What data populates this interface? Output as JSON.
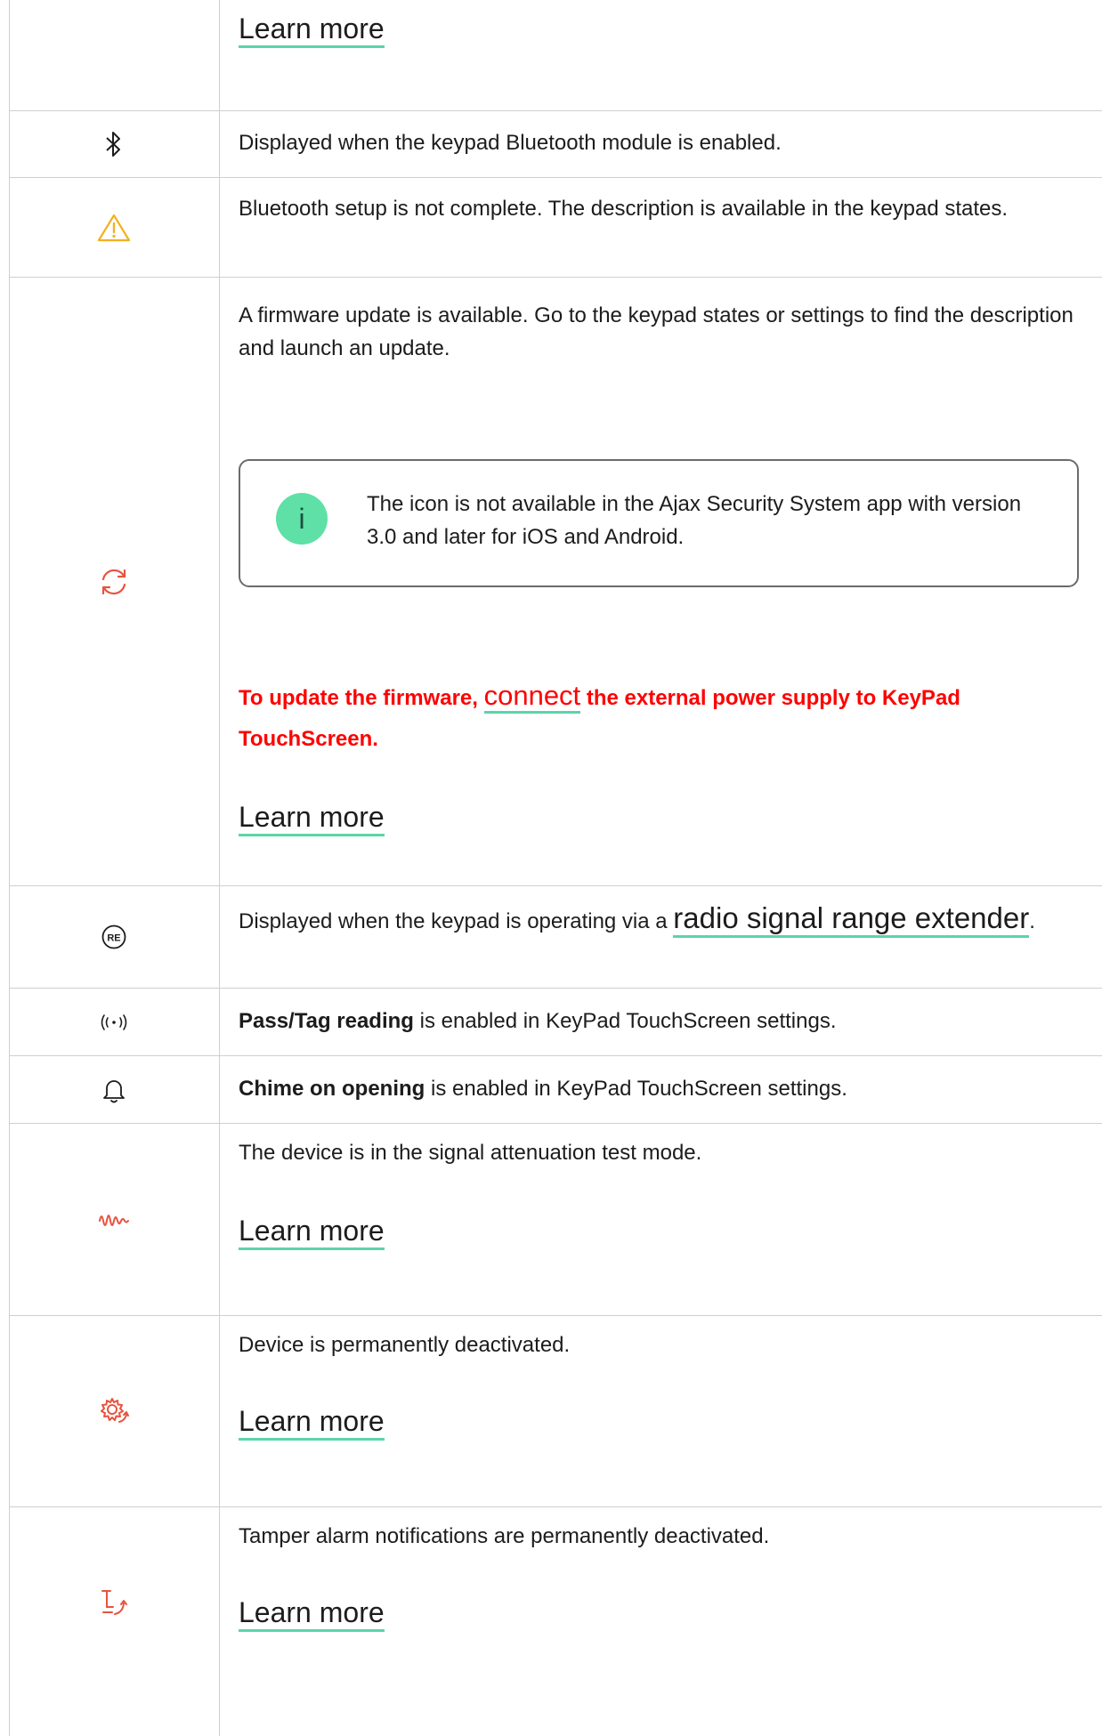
{
  "colors": {
    "accent": "#5cd4a8",
    "warning": "#f2b01e",
    "alert": "#ff0000",
    "icon_red": "#e8533f"
  },
  "rows": [
    {
      "link": "Learn more"
    },
    {
      "icon": "bluetooth-icon",
      "text": "Displayed when the keypad Bluetooth module is enabled."
    },
    {
      "icon": "warning-triangle-icon",
      "text": "Bluetooth setup is not complete. The description is available in the keypad states."
    },
    {
      "icon": "firmware-update-icon",
      "text": "A firmware update is available. Go to the keypad states or settings to find the description and launch an update.",
      "note": "The icon is not available in the Ajax Security System app with version 3.0 and later for iOS and Android.",
      "note_icon": "i",
      "alert_before": "To update the firmware, ",
      "alert_link": "connect",
      "alert_after": " the external power supply to KeyPad TouchScreen.",
      "link": "Learn more"
    },
    {
      "icon": "range-extender-icon",
      "icon_text": "RE",
      "text_before": "Displayed when the keypad is operating via a ",
      "link": "radio signal range extender",
      "text_after": "."
    },
    {
      "icon": "pass-tag-reading-icon",
      "bold": "Pass/Tag reading",
      "text": " is enabled in KeyPad TouchScreen settings."
    },
    {
      "icon": "bell-icon",
      "bold": "Chime on opening",
      "text": " is enabled in KeyPad TouchScreen settings."
    },
    {
      "icon": "signal-attenuation-icon",
      "text": "The device is in the signal attenuation test mode.",
      "link": "Learn more"
    },
    {
      "icon": "deactivated-gear-icon",
      "text": "Device is permanently deactivated.",
      "link": "Learn more"
    },
    {
      "icon": "tamper-deactivated-icon",
      "text": "Tamper alarm notifications are permanently deactivated.",
      "link": "Learn more"
    }
  ]
}
